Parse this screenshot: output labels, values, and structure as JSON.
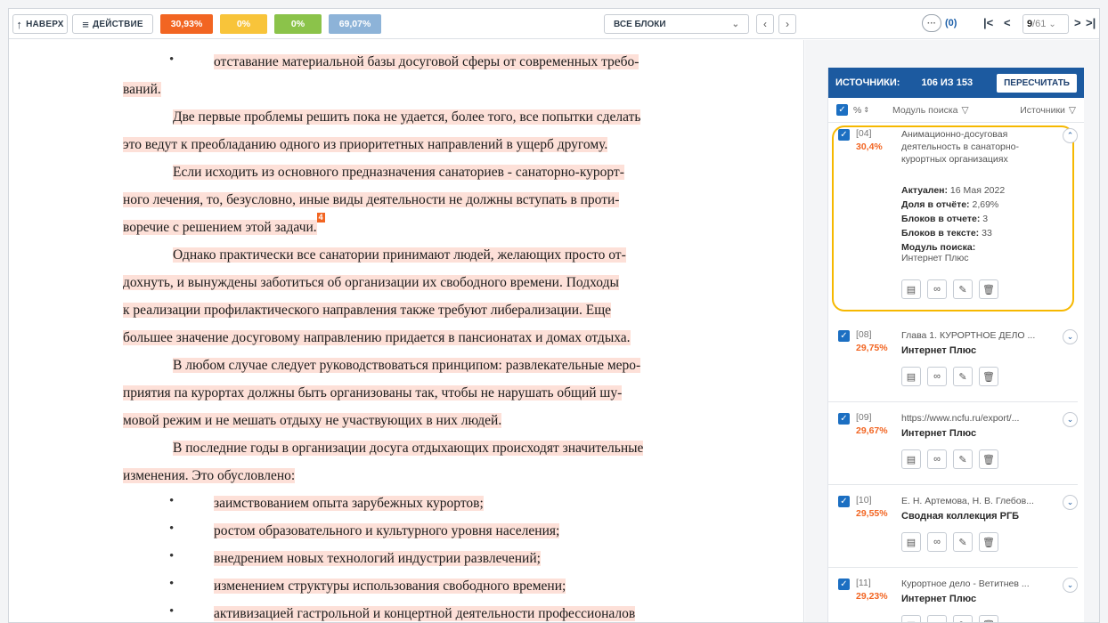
{
  "toolbar": {
    "up_label": "НАВЕРХ",
    "action_label": "ДЕЙСТВИЕ",
    "pills": [
      {
        "label": "30,93%",
        "color": "#f26522"
      },
      {
        "label": "0%",
        "color": "#f8c43a"
      },
      {
        "label": "0%",
        "color": "#8bc34a"
      },
      {
        "label": "69,07%",
        "color": "#8db3d8"
      }
    ],
    "block_select": "ВСЕ БЛОКИ",
    "comments_count": "(0)",
    "page_current": "9",
    "page_total": "/61"
  },
  "document": {
    "lines": [
      {
        "text": "отставание материальной базы досуговой сферы от современных требо-",
        "bullet": true
      },
      {
        "text": "ваний.",
        "bullet": false
      },
      {
        "text": "Две первые проблемы решить пока не удается, более того, все попытки сделать",
        "indent": true
      },
      {
        "text": "это ведут к преобладанию одного из приоритетных направлений в ущерб другому."
      },
      {
        "text": "Если исходить из основного предназначения санаториев - санаторно-курорт-",
        "indent": true
      },
      {
        "text": "ного лечения, то, безусловно, иные виды деятельности не должны вступать в проти-"
      },
      {
        "text": "воречие с решением этой задачи.",
        "marker": "4"
      },
      {
        "text": "Однако практически все санатории принимают людей, желающих просто от-",
        "indent": true
      },
      {
        "text": "дохнуть, и вынуждены заботиться об организации их свободного времени. Подходы"
      },
      {
        "text": "к реализации профилактического направления также требуют либерализации. Еще"
      },
      {
        "text": "большее значение досуговому направлению придается в пансионатах и домах отдыха."
      },
      {
        "text": "В любом случае следует руководствоваться принципом: развлекательные меро-",
        "indent": true
      },
      {
        "text": "приятия па курортах должны быть организованы так, чтобы не нарушать общий шу-"
      },
      {
        "text": "мовой режим и не мешать отдыху не участвующих в них людей."
      },
      {
        "text": "В последние годы в организации досуга отдыхающих происходят значительные",
        "indent": true
      },
      {
        "text": "изменения. Это обусловлено:"
      },
      {
        "text": "заимствованием опыта зарубежных курортов;",
        "bullet": true
      },
      {
        "text": "ростом образовательного и культурного уровня населения;",
        "bullet": true
      },
      {
        "text": "внедрением новых технологий индустрии развлечений;",
        "bullet": true
      },
      {
        "text": "изменением структуры использования свободного времени;",
        "bullet": true
      },
      {
        "text": "активизацией гастрольной и концертной деятельности профессионалов",
        "bullet": true
      }
    ]
  },
  "sources": {
    "header_label": "ИСТОЧНИКИ:",
    "count": "106 ИЗ 153",
    "recalc_label": "ПЕРЕСЧИТАТЬ",
    "col_pct": "%",
    "col_module": "Модуль поиска",
    "col_sources": "Источники",
    "active": {
      "num": "[04]",
      "pct": "30,4%",
      "title_lines": [
        "Анимационно-досуговая",
        "деятельность в санаторно-",
        "курортных организациях"
      ],
      "actual_label": "Актуален:",
      "actual_value": "16 Мая 2022",
      "share_label": "Доля в отчёте:",
      "share_value": "2,69%",
      "blocks_report_label": "Блоков в отчете:",
      "blocks_report_value": "3",
      "blocks_text_label": "Блоков в тексте:",
      "blocks_text_value": "33",
      "module_label": "Модуль поиска:",
      "module_value": "Интернет Плюс"
    },
    "items": [
      {
        "num": "[08]",
        "pct": "29,75%",
        "title": "Глава 1. КУРОРТНОЕ ДЕЛО ...",
        "module": "Интернет Плюс"
      },
      {
        "num": "[09]",
        "pct": "29,67%",
        "title": "https://www.ncfu.ru/export/...",
        "module": "Интернет Плюс"
      },
      {
        "num": "[10]",
        "pct": "29,55%",
        "title": "Е. Н. Артемова, Н. В. Глебов...",
        "module": "Сводная коллекция РГБ"
      },
      {
        "num": "[11]",
        "pct": "29,23%",
        "title": "Курортное дело - Ветитнев ...",
        "module": "Интернет Плюс"
      }
    ]
  }
}
